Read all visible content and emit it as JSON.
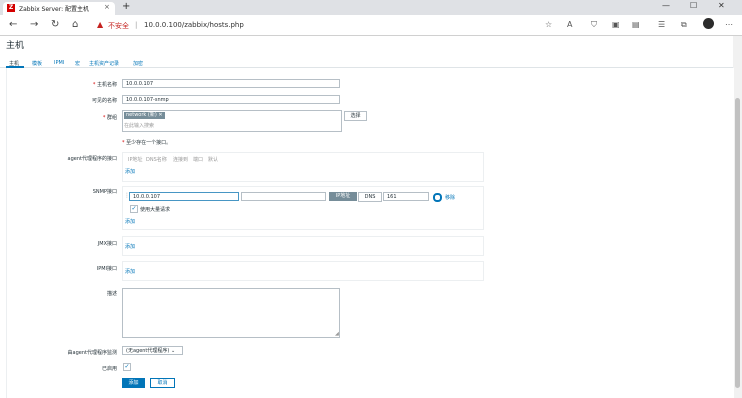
{
  "browser": {
    "tab_title": "Zabbix Server: 配置主机",
    "tab_icon_letter": "Z",
    "tab_close": "×",
    "new_tab": "+",
    "min": "—",
    "max": "☐",
    "close": "✕",
    "back": "←",
    "forward": "→",
    "reload": "↻",
    "home": "⌂",
    "warn_icon": "▲",
    "insecure_label": "不安全",
    "separator": "|",
    "url": "10.0.0.100/zabbix/hosts.php"
  },
  "page": {
    "title": "主机",
    "tabs": [
      "主机",
      "模板",
      "IPMI",
      "宏",
      "主机资产记录",
      "加密"
    ]
  },
  "form": {
    "hostname_label": "主机名称",
    "hostname_value": "10.0.0.107",
    "visible_name_label": "可见的名称",
    "visible_name_value": "10.0.0.107-snmp",
    "groups_label": "群组",
    "group_tag": "network (新)",
    "group_tag_remove": "✕",
    "groups_placeholder": "在此输入搜索",
    "select_button": "选择",
    "interface_note": "至少存在一个接口。",
    "agent_label": "agent代理程序的接口",
    "agent_headers": [
      "IP地址",
      "DNS名称",
      "连接到",
      "端口",
      "默认"
    ],
    "add_link": "添加",
    "snmp_label": "SNMP接口",
    "snmp_ip": "10.0.0.107",
    "snmp_dns": "",
    "ip_toggle": "IP地址",
    "dns_toggle": "DNS",
    "snmp_port": "161",
    "remove_link": "移除",
    "bulk_label": "使用大量请求",
    "jmx_label": "JMX接口",
    "ipmi_label": "IPMI接口",
    "description_label": "描述",
    "proxy_label": "由agent代理程序监测",
    "proxy_value": "(无agent代理程序)",
    "enabled_label": "已启用",
    "check": "✓",
    "add_button": "添加",
    "cancel_button": "取消"
  }
}
